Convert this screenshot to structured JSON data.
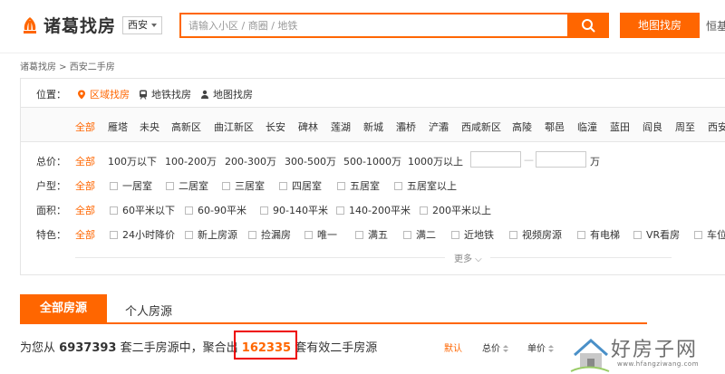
{
  "header": {
    "logo_text": "诸葛找房",
    "city": "西安",
    "search_placeholder": "请输入小区 / 商圈 / 地铁",
    "map_button": "地图找房",
    "right_link": "恒基"
  },
  "breadcrumb": "诸葛找房 > 西安二手房",
  "position": {
    "label": "位置：",
    "tabs": [
      "区域找房",
      "地铁找房",
      "地图找房"
    ]
  },
  "districts": [
    "全部",
    "雁塔",
    "未央",
    "高新区",
    "曲江新区",
    "长安",
    "碑林",
    "莲湖",
    "新城",
    "灞桥",
    "浐灞",
    "西咸新区",
    "高陵",
    "鄠邑",
    "临潼",
    "蓝田",
    "阎良",
    "周至",
    "西安"
  ],
  "price": {
    "label": "总价：",
    "options": [
      "全部",
      "100万以下",
      "100-200万",
      "200-300万",
      "300-500万",
      "500-1000万",
      "1000万以上"
    ],
    "separator": "—",
    "unit": "万"
  },
  "layout": {
    "label": "户型：",
    "options": [
      "全部",
      "一居室",
      "二居室",
      "三居室",
      "四居室",
      "五居室",
      "五居室以上"
    ]
  },
  "area": {
    "label": "面积：",
    "options": [
      "全部",
      "60平米以下",
      "60-90平米",
      "90-140平米",
      "140-200平米",
      "200平米以上"
    ]
  },
  "features": {
    "label": "特色：",
    "options": [
      "全部",
      "24小时降价",
      "新上房源",
      "捡漏房",
      "唯一",
      "满五",
      "满二",
      "近地铁",
      "视频房源",
      "有电梯",
      "VR看房",
      "车位"
    ]
  },
  "more": "更多 ⌵",
  "tabs": [
    "全部房源",
    "个人房源"
  ],
  "summary": {
    "prefix": "为您从",
    "total": "6937393",
    "mid": "套二手房源中，聚合出",
    "count": "162335",
    "suffix": "套有效二手房源"
  },
  "sort": [
    "默认",
    "总价",
    "单价"
  ],
  "watermark": {
    "text": "好房子网",
    "url": "www.hfangziwang.com"
  },
  "colors": {
    "accent": "#ff6600",
    "highlight_border": "#e00000"
  }
}
